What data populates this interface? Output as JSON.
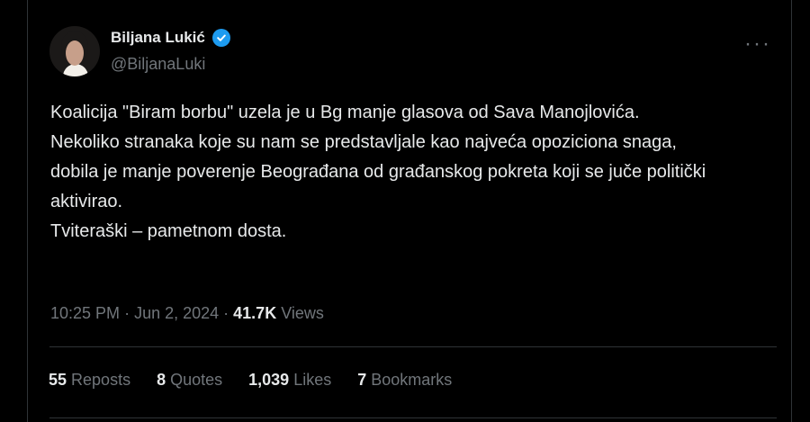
{
  "author": {
    "name": "Biljana Lukić",
    "handle": "@BiljanaLuki",
    "verified": true
  },
  "tweet": {
    "text": "Koalicija \"Biram borbu\" uzela je u Bg manje glasova od Sava Manojlovića.\nNekoliko stranaka koje su nam se predstavljale kao najveća opoziciona snaga,\ndobila je manje poverenje Beograđana od građanskog pokreta koji se juče politički aktivirao.\nTviteraški – pametnom dosta."
  },
  "meta": {
    "time": "10:25 PM",
    "date": "Jun 2, 2024",
    "views_count": "41.7K",
    "views_label": "Views"
  },
  "stats": [
    {
      "count": "55",
      "label": "Reposts"
    },
    {
      "count": "8",
      "label": "Quotes"
    },
    {
      "count": "1,039",
      "label": "Likes"
    },
    {
      "count": "7",
      "label": "Bookmarks"
    }
  ],
  "icons": {
    "verified": "verified-badge-icon",
    "more": "more-options-icon"
  },
  "colors": {
    "background": "#000000",
    "text": "#e7e9ea",
    "muted": "#71767b",
    "accent": "#1d9bf0",
    "border": "#2f3336"
  }
}
